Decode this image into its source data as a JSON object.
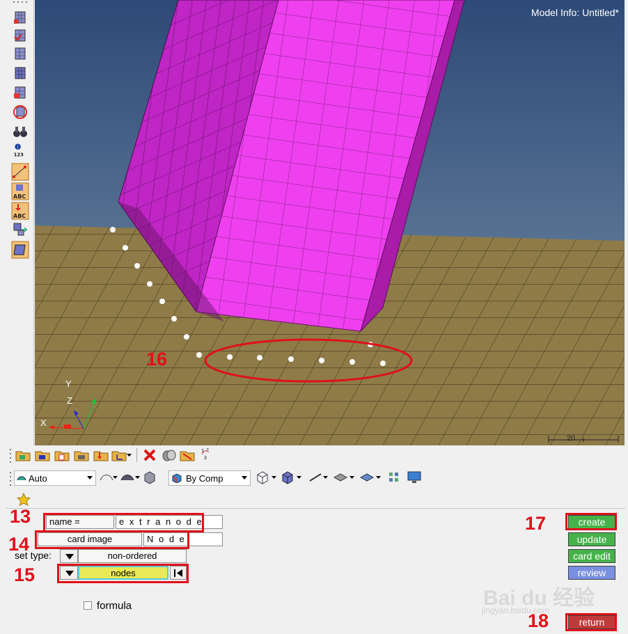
{
  "viewport": {
    "model_info": "Model Info: Untitled*",
    "scale_label": "20"
  },
  "triad": {
    "x": "X",
    "y": "Y",
    "z": "Z"
  },
  "toolbar1": {},
  "toolbar2": {
    "auto_label": "Auto",
    "bycomp_label": "By Comp"
  },
  "form": {
    "name_label": "name =",
    "name_value": "e x t r a n o d e",
    "card_image_label": "card image",
    "card_image_value": "N o d e",
    "set_type_label": "set type:",
    "set_type_value": "non-ordered",
    "entity_value": "nodes",
    "formula_label": "formula"
  },
  "buttons": {
    "create": "create",
    "update": "update",
    "card_edit": "card edit",
    "review": "review",
    "return": "return"
  },
  "callouts": {
    "c13": "13",
    "c14": "14",
    "c15": "15",
    "c16": "16",
    "c17": "17",
    "c18": "18"
  },
  "watermark": {
    "brand": "Bai du 经验",
    "url": "jingyan.baidu.com"
  },
  "colors": {
    "sky_top": "#2d4a78",
    "sky_bottom": "#6f8aa3",
    "ground": "#8e7b48",
    "mesh_magenta": "#e83be8",
    "callout_red": "#e0101a",
    "button_green": "#46b24a",
    "button_blue": "#7a8fe0",
    "button_red": "#c03a3a"
  }
}
